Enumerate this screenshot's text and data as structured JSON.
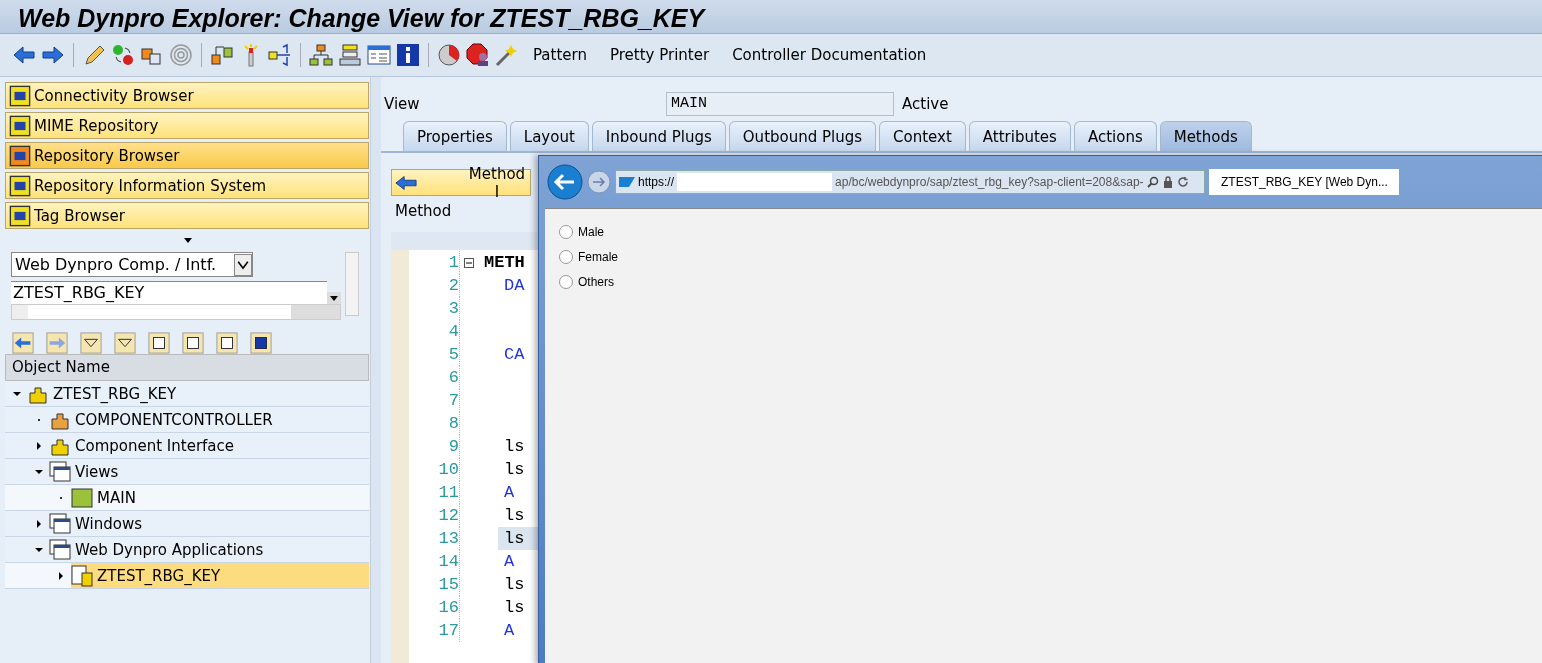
{
  "window": {
    "title": "Web Dynpro Explorer: Change View for ZTEST_RBG_KEY"
  },
  "toolbar": {
    "icons": [
      {
        "kind": "back"
      },
      {
        "kind": "forward"
      },
      {
        "kind": "sep"
      },
      {
        "kind": "pencil"
      },
      {
        "kind": "toggle"
      },
      {
        "kind": "copy"
      },
      {
        "kind": "spiral"
      },
      {
        "kind": "sep"
      },
      {
        "kind": "nodes"
      },
      {
        "kind": "pin"
      },
      {
        "kind": "branch"
      },
      {
        "kind": "sep"
      },
      {
        "kind": "hierarchy"
      },
      {
        "kind": "stack"
      },
      {
        "kind": "layout"
      },
      {
        "kind": "info"
      },
      {
        "kind": "sep"
      },
      {
        "kind": "pie"
      },
      {
        "kind": "stop"
      },
      {
        "kind": "wand"
      }
    ],
    "buttons": [
      "Pattern",
      "Pretty Printer",
      "Controller Documentation"
    ]
  },
  "nav_buttons": [
    {
      "label": "Connectivity Browser",
      "selected": false
    },
    {
      "label": "MIME Repository",
      "selected": false
    },
    {
      "label": "Repository Browser",
      "selected": true
    },
    {
      "label": "Repository Information System",
      "selected": false
    },
    {
      "label": "Tag Browser",
      "selected": false
    }
  ],
  "object_type": {
    "value": "Web Dynpro Comp. / Intf."
  },
  "object_name_field": {
    "value": "ZTEST_RBG_KEY"
  },
  "tree": {
    "header": "Object Name",
    "items": [
      {
        "label": "ZTEST_RBG_KEY",
        "kind": "component",
        "expanded": true,
        "selected": false,
        "children": [
          {
            "label": "COMPONENTCONTROLLER",
            "kind": "controller",
            "selected": false
          },
          {
            "label": "Component Interface",
            "kind": "component",
            "expanded": false,
            "selected": false
          },
          {
            "label": "Views",
            "kind": "views",
            "expanded": true,
            "selected": false,
            "children": [
              {
                "label": "MAIN",
                "kind": "view",
                "selected": false
              }
            ]
          },
          {
            "label": "Windows",
            "kind": "views",
            "expanded": false,
            "selected": false
          },
          {
            "label": "Web Dynpro Applications",
            "kind": "apps",
            "expanded": true,
            "selected": false,
            "children": [
              {
                "label": "ZTEST_RBG_KEY",
                "kind": "app",
                "expanded": false,
                "selected": true
              }
            ]
          }
        ]
      }
    ]
  },
  "view": {
    "label": "View",
    "value": "MAIN",
    "status": "Active"
  },
  "tabs": [
    {
      "label": "Properties",
      "selected": false
    },
    {
      "label": "Layout",
      "selected": false
    },
    {
      "label": "Inbound Plugs",
      "selected": false
    },
    {
      "label": "Outbound Plugs",
      "selected": false
    },
    {
      "label": "Context",
      "selected": false
    },
    {
      "label": "Attributes",
      "selected": false
    },
    {
      "label": "Actions",
      "selected": false
    },
    {
      "label": "Methods",
      "selected": true
    }
  ],
  "method_button": "Method I",
  "method_column": "Method",
  "code": [
    {
      "no": "1",
      "text": "METH",
      "kind": "keyword",
      "selected": false
    },
    {
      "no": "2",
      "text": "DA",
      "kind": "blue",
      "selected": false
    },
    {
      "no": "3",
      "kind": "plain",
      "selected": false
    },
    {
      "no": "4",
      "kind": "plain",
      "selected": false
    },
    {
      "no": "5",
      "text": "CA",
      "kind": "blue",
      "selected": false
    },
    {
      "no": "6",
      "kind": "plain",
      "selected": false
    },
    {
      "no": "7",
      "kind": "plain",
      "selected": false
    },
    {
      "no": "8",
      "kind": "plain",
      "selected": false
    },
    {
      "no": "9",
      "text": "ls",
      "kind": "plain",
      "selected": false
    },
    {
      "no": "10",
      "text": "ls",
      "kind": "plain",
      "selected": false
    },
    {
      "no": "11",
      "text": "A",
      "kind": "blue",
      "selected": false
    },
    {
      "no": "12",
      "text": "ls",
      "kind": "plain",
      "selected": false
    },
    {
      "no": "13",
      "text": "ls",
      "kind": "plain",
      "selected": true
    },
    {
      "no": "14",
      "text": "A",
      "kind": "blue",
      "selected": false
    },
    {
      "no": "15",
      "text": "ls",
      "kind": "plain",
      "selected": false
    },
    {
      "no": "16",
      "text": "ls",
      "kind": "plain",
      "selected": false
    },
    {
      "no": "17",
      "text": "A",
      "kind": "blue",
      "selected": false
    }
  ],
  "browser": {
    "address_start": "https://",
    "address_end": "ap/bc/webdynpro/sap/ztest_rbg_key?sap-client=208&sap-",
    "tab": "ZTEST_RBG_KEY [Web Dyn...",
    "radios": [
      {
        "label": "Male",
        "selected": false
      },
      {
        "label": "Female",
        "selected": false
      },
      {
        "label": "Others",
        "selected": false
      }
    ]
  }
}
